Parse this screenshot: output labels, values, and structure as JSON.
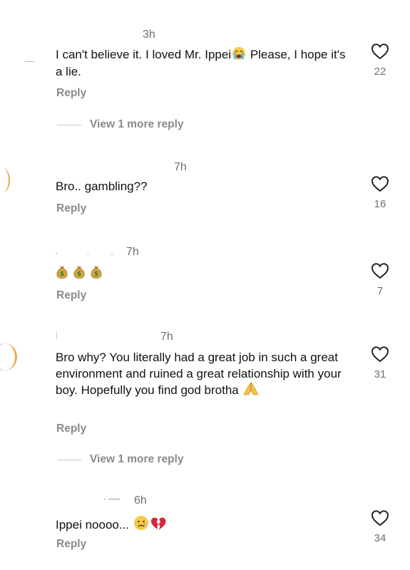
{
  "comments": [
    {
      "time": "3h",
      "text_before_emoji": "I can't believe it. I loved Mr. Ippei",
      "emoji_1": "crying-face-emoji",
      "text_after_emoji": " Please, I hope it's a lie.",
      "likes": "22",
      "reply_label": "Reply",
      "view_more": "View 1 more reply"
    },
    {
      "time": "7h",
      "text": "Bro.. gambling??",
      "likes": "16",
      "reply_label": "Reply"
    },
    {
      "time": "7h",
      "emojis": [
        "money-bag-emoji",
        "money-bag-emoji",
        "money-bag-emoji"
      ],
      "likes": "7",
      "reply_label": "Reply"
    },
    {
      "time": "7h",
      "text": "Bro why? You literally had a great job in such a great environment and ruined a great relationship with your boy. Hopefully you find god brotha",
      "emoji_1": "folded-hands-emoji",
      "likes": "31",
      "reply_label": "Reply",
      "view_more": "View 1 more reply"
    },
    {
      "time": "6h",
      "text": "Ippei noooo...",
      "emoji_1": "crying-face-emoji",
      "emoji_2": "broken-heart-emoji",
      "likes": "34",
      "reply_label": "Reply"
    }
  ],
  "colors": {
    "text": "#111111",
    "secondary": "#8a8a8a",
    "time": "#6f6f6f",
    "heart_outline": "#262626"
  }
}
